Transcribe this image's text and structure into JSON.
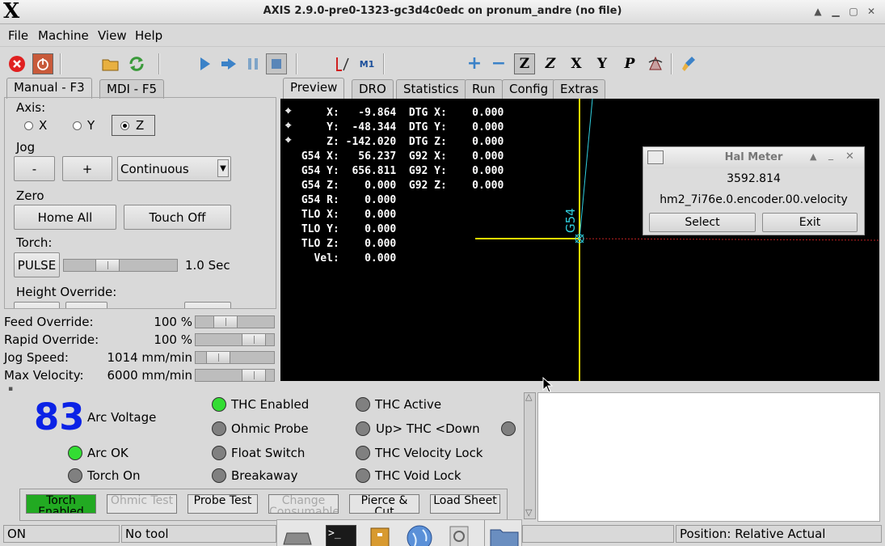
{
  "window": {
    "title": "AXIS 2.9.0-pre0-1323-gc3d4c0edc on pronum_andre (no file)",
    "logo": "X"
  },
  "menu": [
    "File",
    "Machine",
    "View",
    "Help"
  ],
  "toolbar_icons": [
    "estop-icon",
    "power-icon",
    "open-icon",
    "reload-icon",
    "run-icon",
    "step-icon",
    "pause-icon",
    "stop-icon",
    "block-delete-icon",
    "optional-stop-icon",
    "zoom-in-icon",
    "zoom-out-icon",
    "view-z-icon",
    "view-z2-icon",
    "view-x-icon",
    "view-y-icon",
    "view-p-icon",
    "rotate-icon",
    "clear-icon"
  ],
  "toolbar_text": {
    "optional_stop": "M1",
    "view_z": "Z",
    "view_x": "X",
    "view_y": "Y",
    "view_p": "P"
  },
  "left_tabs": [
    "Manual - F3",
    "MDI - F5"
  ],
  "manual": {
    "axis_label": "Axis:",
    "axes": [
      "X",
      "Y",
      "Z"
    ],
    "selected_axis": "Z",
    "jog_label": "Jog",
    "jog_minus": "-",
    "jog_plus": "+",
    "jog_mode": "Continuous",
    "zero_label": "Zero",
    "home_all": "Home All",
    "touch_off": "Touch Off",
    "torch_label": "Torch:",
    "pulse": "PULSE",
    "pulse_value": "1.0 Sec",
    "pulse_level": 0.35,
    "height_override": "Height Override:"
  },
  "overrides": [
    {
      "label": "Feed Override:",
      "value": "100 %",
      "level": 0.33
    },
    {
      "label": "Rapid Override:",
      "value": "100 %",
      "level": 0.85
    },
    {
      "label": "Jog Speed:",
      "value": "1014 mm/min",
      "level": 0.2
    },
    {
      "label": "Max Velocity:",
      "value": "6000 mm/min",
      "level": 0.85
    }
  ],
  "right_tabs": [
    "Preview",
    "DRO",
    "Statistics",
    "Run",
    "Config",
    "Extras"
  ],
  "dro_lines": [
    "     X:   -9.864  DTG X:    0.000",
    "     Y:  -48.344  DTG Y:    0.000",
    "     Z: -142.020  DTG Z:    0.000",
    " G54 X:   56.237  G92 X:    0.000",
    " G54 Y:  656.811  G92 Y:    0.000",
    " G54 Z:    0.000  G92 Z:    0.000",
    " G54 R:    0.000",
    " TLO X:    0.000",
    " TLO Y:    0.000",
    " TLO Z:    0.000",
    "   Vel:    0.000"
  ],
  "preview_label": "G54",
  "halmeter": {
    "title": "Hal Meter",
    "value": "3592.814",
    "pin": "hm2_7i76e.0.encoder.00.velocity",
    "select": "Select",
    "exit": "Exit"
  },
  "plasma": {
    "arc_voltage_value": "83",
    "arc_voltage_label": "Arc Voltage",
    "leds": [
      {
        "label": "THC Enabled",
        "on": true
      },
      {
        "label": "Ohmic Probe",
        "on": false
      },
      {
        "label": "Float Switch",
        "on": false
      },
      {
        "label": "Breakaway",
        "on": false
      },
      {
        "label": "THC Active",
        "on": false
      },
      {
        "label": "Up> THC <Down",
        "on": false
      },
      {
        "label": "THC Velocity Lock",
        "on": false
      },
      {
        "label": "THC Void Lock",
        "on": false
      },
      {
        "label": "Arc OK",
        "on": true
      },
      {
        "label": "Torch On",
        "on": false
      }
    ],
    "buttons": [
      "Torch Enabled",
      "Ohmic Test",
      "Probe Test",
      "Change Consumable",
      "Pierce & Cut",
      "Load Sheet"
    ]
  },
  "status": {
    "state": "ON",
    "tool": "No tool",
    "position": "Position: Relative Actual"
  },
  "colors": {
    "led_on": "#33dd33",
    "arc_voltage": "#0b22e6",
    "torch_enabled": "#22aa22"
  }
}
